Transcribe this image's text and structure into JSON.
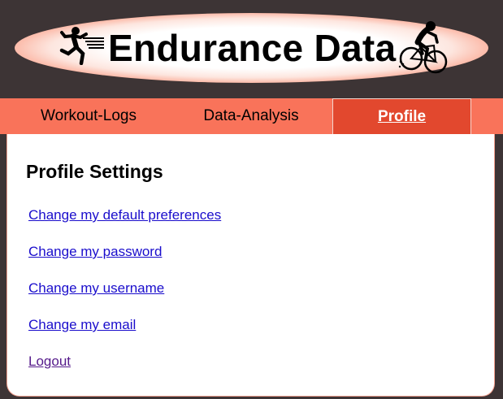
{
  "header": {
    "title": "Endurance Data",
    "left_icon": "running-man-icon",
    "right_icon": "cyclist-icon"
  },
  "nav": {
    "tabs": [
      {
        "label": "Workout-Logs",
        "active": false
      },
      {
        "label": "Data-Analysis",
        "active": false
      },
      {
        "label": "Profile",
        "active": true
      }
    ]
  },
  "main": {
    "heading": "Profile Settings",
    "links": [
      {
        "label": "Change my default preferences"
      },
      {
        "label": "Change my password"
      },
      {
        "label": "Change my username"
      },
      {
        "label": "Change my email"
      },
      {
        "label": "Logout",
        "visited": true
      }
    ]
  },
  "colors": {
    "page_background": "#3d3435",
    "nav_background": "#f9735a",
    "active_tab": "#e2482e",
    "link": "#1a0dcc",
    "visited_link": "#551a8b"
  }
}
